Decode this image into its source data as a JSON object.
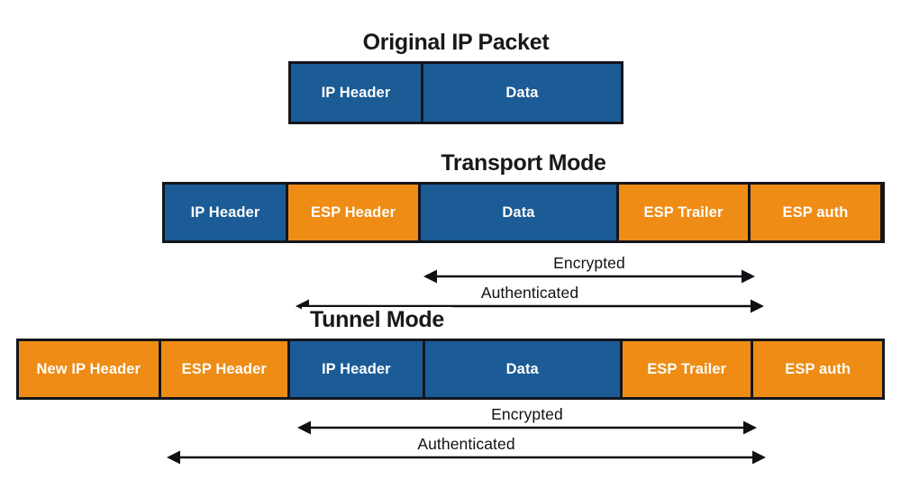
{
  "diagram": {
    "title_semantic": "ipsec-esp-transport-vs-tunnel-mode",
    "colors": {
      "blue": "#1B5B96",
      "orange": "#EE8C15",
      "outline": "#14161c",
      "text_on_fill": "#FDFDFB",
      "text_dark": "#18181A",
      "background": "#FFFFFF"
    }
  },
  "sections": {
    "original": {
      "title": "Original IP Packet",
      "fields": [
        {
          "label": "IP Header",
          "color": "blue"
        },
        {
          "label": "Data",
          "color": "blue"
        }
      ]
    },
    "transport": {
      "title": "Transport Mode",
      "fields": [
        {
          "label": "IP Header",
          "color": "blue"
        },
        {
          "label": "ESP Header",
          "color": "orange"
        },
        {
          "label": "Data",
          "color": "blue"
        },
        {
          "label": "ESP Trailer",
          "color": "orange"
        },
        {
          "label": "ESP auth",
          "color": "orange"
        }
      ],
      "annotations": [
        {
          "label": "Encrypted"
        },
        {
          "label": "Authenticated"
        }
      ]
    },
    "tunnel": {
      "title": "Tunnel Mode",
      "fields": [
        {
          "label": "New IP Header",
          "color": "orange"
        },
        {
          "label": "ESP Header",
          "color": "orange"
        },
        {
          "label": "IP Header",
          "color": "blue"
        },
        {
          "label": "Data",
          "color": "blue"
        },
        {
          "label": "ESP Trailer",
          "color": "orange"
        },
        {
          "label": "ESP auth",
          "color": "orange"
        }
      ],
      "annotations": [
        {
          "label": "Encrypted"
        },
        {
          "label": "Authenticated"
        }
      ]
    }
  }
}
